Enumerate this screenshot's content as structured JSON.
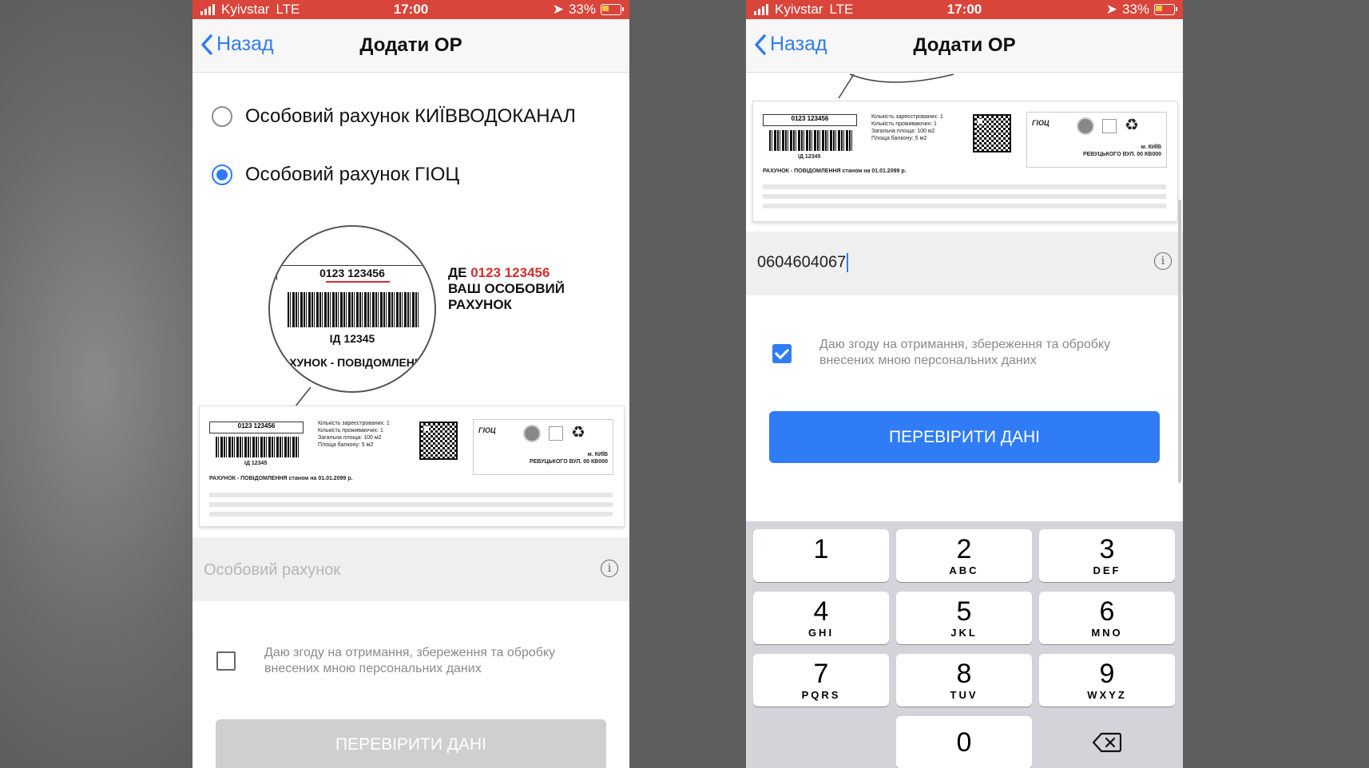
{
  "status_bar": {
    "carrier": "Kyivstar",
    "network": "LTE",
    "time": "17:00",
    "battery": "33%"
  },
  "nav": {
    "back_label": "Назад",
    "title": "Додати ОР"
  },
  "left": {
    "radio_options": [
      {
        "label": "Особовий рахунок КИЇВВОДОКАНАЛ",
        "selected": false
      },
      {
        "label": "Особовий рахунок ГІОЦ",
        "selected": true
      }
    ],
    "illustration": {
      "zoom_account": "0123 123456",
      "zoom_id": "ІД 12345",
      "zoom_caption": "АХУНОК - ПОВІДОМЛЕНН",
      "hint_prefix": "ДЕ",
      "hint_number": "0123 123456",
      "hint_line2": "ВАШ ОСОБОВИЙ",
      "hint_line3": "РАХУНОК"
    },
    "bill": {
      "account": "0123 123456",
      "id": "ІД 12345",
      "info_lines": [
        "Кількість зареєстрованих: 1",
        "Кількість проживаючих: 1",
        "Загальна площа: 100 м2",
        "Площа балкону: 5 м2"
      ],
      "caption": "РАХУНОК - ПОВІДОМЛЕННЯ станом на 01.01.2099 р.",
      "logo_text": "ГІОЦ",
      "address_city": "м. КИЇВ",
      "address_street": "РЕВУЦЬКОГО ВУЛ. 00 КВ000"
    },
    "account_field_placeholder": "Особовий рахунок",
    "consent_text": "Даю згоду на отримання, збереження та обробку внесених мною персональних даних",
    "consent_checked": false,
    "button_label": "ПЕРЕВІРИТИ ДАНІ",
    "button_state": "disabled"
  },
  "right": {
    "bill": {
      "account": "0123 123456",
      "id": "ІД 12345",
      "info_lines": [
        "Кількість зареєстрованих: 1",
        "Кількість проживаючих: 1",
        "Загальна площа: 100 м2",
        "Площа балкону: 5 м2"
      ],
      "caption": "РАХУНОК - ПОВІДОМЛЕННЯ станом на 01.01.2099 р.",
      "logo_text": "ГІОЦ",
      "address_city": "м. КИЇВ",
      "address_street": "РЕВУЦЬКОГО ВУЛ. 00 КВ000"
    },
    "account_field_value": "0604604067",
    "consent_text": "Даю згоду на отримання, збереження та обробку внесених мною персональних даних",
    "consent_checked": true,
    "button_label": "ПЕРЕВІРИТИ ДАНІ",
    "button_state": "active"
  },
  "keyboard": {
    "keys": [
      {
        "num": "1",
        "letters": ""
      },
      {
        "num": "2",
        "letters": "ABC"
      },
      {
        "num": "3",
        "letters": "DEF"
      },
      {
        "num": "4",
        "letters": "GHI"
      },
      {
        "num": "5",
        "letters": "JKL"
      },
      {
        "num": "6",
        "letters": "MNO"
      },
      {
        "num": "7",
        "letters": "PQRS"
      },
      {
        "num": "8",
        "letters": "TUV"
      },
      {
        "num": "9",
        "letters": "WXYZ"
      },
      {
        "num": "0",
        "letters": ""
      }
    ]
  },
  "colors": {
    "status_bar": "#d9453b",
    "accent": "#2f7cf6",
    "disabled_button": "#cfcfcf",
    "hint_red": "#d32f2f"
  }
}
